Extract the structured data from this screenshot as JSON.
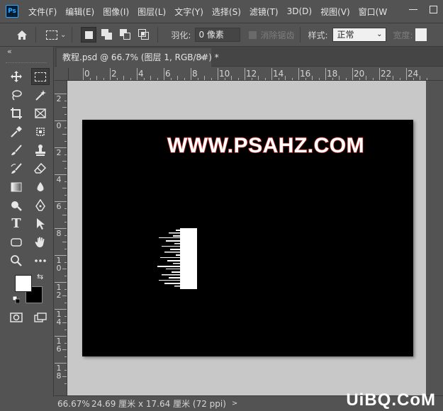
{
  "app": {
    "logo": "Ps"
  },
  "menu": [
    "文件(F)",
    "编辑(E)",
    "图像(I)",
    "图层(L)",
    "文字(Y)",
    "选择(S)",
    "滤镜(T)",
    "3D(D)",
    "视图(V)",
    "窗口(W"
  ],
  "options": {
    "feather_label": "羽化:",
    "feather_value": "0 像素",
    "antialias_label": "消除锯齿",
    "style_label": "样式:",
    "style_value": "正常",
    "width_label": "宽度:"
  },
  "toolbar": {
    "collapse": "«"
  },
  "document": {
    "tab_title": "教程.psd @ 66.7% (图层 1, RGB/8#) *",
    "close": "×"
  },
  "ruler": {
    "h_labels": [
      "0",
      "2",
      "4",
      "6",
      "8",
      "10",
      "12",
      "14",
      "16",
      "18",
      "20",
      "22",
      "24"
    ],
    "v_labels": [
      "2",
      "0",
      "2",
      "4",
      "6",
      "8",
      "1 0",
      "1 2",
      "1 4",
      "1 6",
      "1 8"
    ]
  },
  "canvas": {
    "background": "#000000",
    "watermark_text": "WWW.PSAHZ.COM",
    "watermark_stroke": "#c0201a"
  },
  "status": {
    "zoom": "66.67%",
    "doc_info": "24.69 厘米 x 17.64 厘米 (72 ppi)",
    "arrow": ">"
  },
  "site_logo": "UiBQ.CoM"
}
